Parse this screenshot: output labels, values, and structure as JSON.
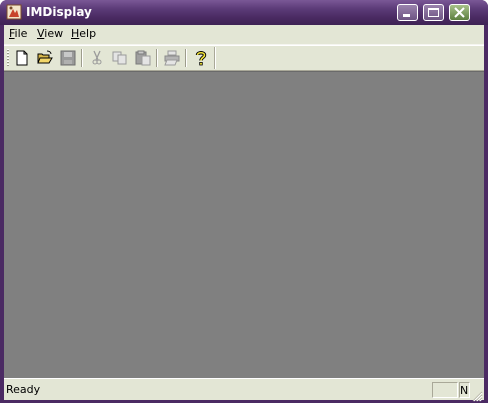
{
  "window": {
    "title": "IMDisplay",
    "colors": {
      "titlebar": "#5c3b78",
      "frame": "#4b2a63",
      "workspace": "#808080",
      "chrome": "#e3e6d5"
    }
  },
  "caption_buttons": [
    "minimize-icon",
    "maximize-icon",
    "close-icon"
  ],
  "menubar": {
    "items": [
      {
        "mnemonic": "F",
        "rest": "ile"
      },
      {
        "mnemonic": "V",
        "rest": "iew"
      },
      {
        "mnemonic": "H",
        "rest": "elp"
      }
    ]
  },
  "toolbar": {
    "buttons": [
      {
        "icon": "new-document-icon",
        "enabled": true
      },
      {
        "icon": "open-folder-icon",
        "enabled": true
      },
      {
        "icon": "save-disk-icon",
        "enabled": false
      },
      {
        "icon": "cut-icon",
        "enabled": false
      },
      {
        "icon": "copy-icon",
        "enabled": false
      },
      {
        "icon": "paste-icon",
        "enabled": false
      },
      {
        "icon": "print-icon",
        "enabled": false
      },
      {
        "icon": "help-icon",
        "enabled": true
      }
    ]
  },
  "statusbar": {
    "text": "Ready",
    "panes": [
      "",
      "N"
    ]
  }
}
